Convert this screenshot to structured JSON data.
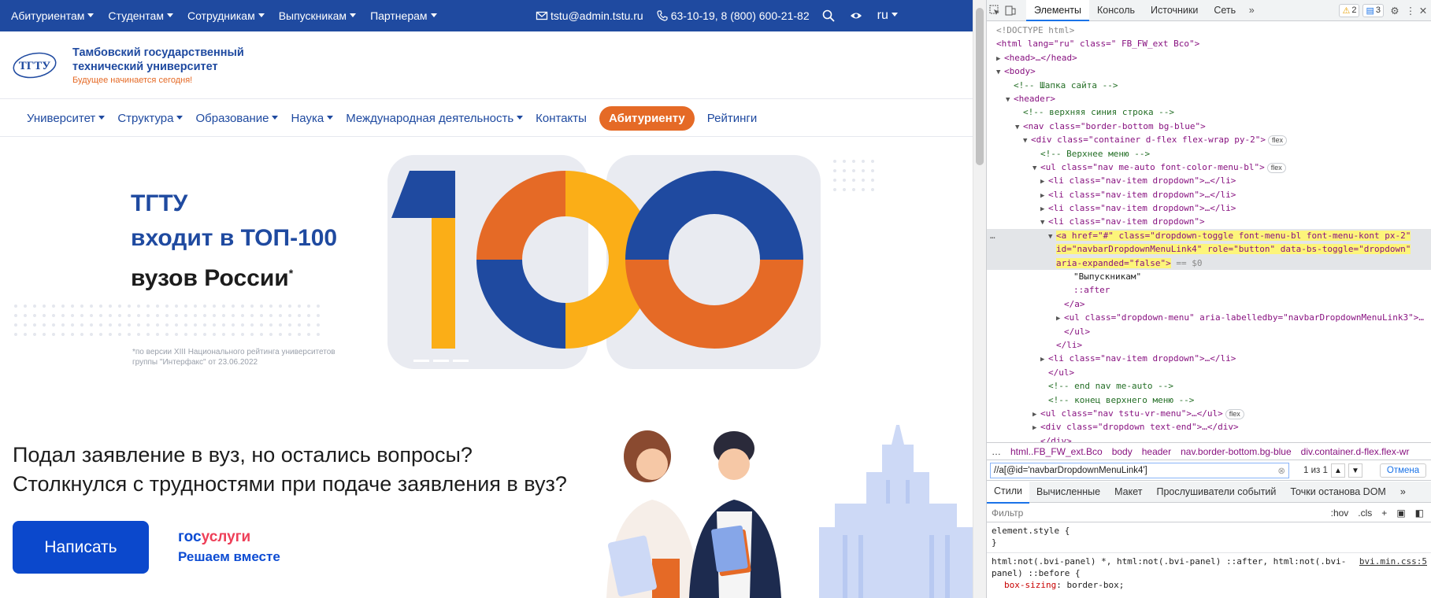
{
  "site": {
    "topbar": {
      "menu": [
        "Абитуриентам",
        "Студентам",
        "Сотрудникам",
        "Выпускникам",
        "Партнерам"
      ],
      "email": "tstu@admin.tstu.ru",
      "phone": "63-10-19, 8 (800) 600-21-82",
      "lang": "ru"
    },
    "brand": {
      "logo_text": "ТГТУ",
      "name_line1": "Тамбовский государственный",
      "name_line2": "технический университет",
      "motto": "Будущее  начинается сегодня!"
    },
    "mainnav": {
      "items": [
        "Университет",
        "Структура",
        "Образование",
        "Наука",
        "Международная деятельность"
      ],
      "contacts": "Контакты",
      "applicant": "Абитуриенту",
      "ratings": "Рейтинги"
    },
    "banner": {
      "line1": "ТГТУ",
      "line2": "входит в ТОП-100",
      "line3": "вузов России",
      "star": "*",
      "note1": "*по версии XIII Национального рейтинга университетов",
      "note2": " группы \"Интерфакс\" от 23.06.2022"
    },
    "promo": {
      "question1": "Подал заявление в вуз, но остались вопросы?",
      "question2": "Столкнулся с трудностями при подаче заявления в вуз?",
      "button": "Написать",
      "gos1": "гос",
      "gos2": "услуги",
      "gos_sub": "Решаем вместе"
    },
    "colors": {
      "brand_blue": "#1f4aa0",
      "accent_orange": "#e56a26",
      "yellow": "#fbae17"
    }
  },
  "devtools": {
    "tabs": [
      "Элементы",
      "Консоль",
      "Источники",
      "Сеть"
    ],
    "warnings": "2",
    "messages": "3",
    "tree": [
      {
        "t": "<!DOCTYPE html>"
      },
      {
        "t": "<html lang=\"ru\" class=\" FB_FW_ext Bco\">"
      },
      {
        "t": "<head>…</head>"
      },
      {
        "t": "<body>"
      },
      {
        "t": "<!-- Шапка сайта -->"
      },
      {
        "t": "<header>"
      },
      {
        "t": "<!-- верхняя синия строка -->"
      },
      {
        "t": "<nav class=\"border-bottom bg-blue\">"
      },
      {
        "t": "<div class=\"container d-flex flex-wrap py-2\">"
      },
      {
        "t": "<!-- Верхнее меню -->"
      },
      {
        "t": "<ul class=\"nav me-auto font-color-menu-bl\">"
      },
      {
        "t": "<li class=\"nav-item dropdown\">…</li>"
      },
      {
        "t": "<li class=\"nav-item dropdown\">…</li>"
      },
      {
        "t": "<li class=\"nav-item dropdown\">…</li>"
      },
      {
        "t": "<li class=\"nav-item dropdown\">"
      },
      {
        "t": "<a href=\"#\" class=\"dropdown-toggle font-menu-bl font-menu-kont px-2\""
      },
      {
        "t": "id=\"navbarDropdownMenuLink4\" role=\"button\" data-bs-toggle=\"dropdown\""
      },
      {
        "t": "aria-expanded=\"false\">"
      },
      {
        "t": "\"Выпускникам\""
      },
      {
        "t": "::after"
      },
      {
        "t": "</a>"
      },
      {
        "t": "<ul class=\"dropdown-menu\" aria-labelledby=\"navbarDropdownMenuLink3\">…"
      },
      {
        "t": "</ul>"
      },
      {
        "t": "</li>"
      },
      {
        "t": "<li class=\"nav-item dropdown\">…</li>"
      },
      {
        "t": "</ul>"
      },
      {
        "t": "<!-- end  nav me-auto -->"
      },
      {
        "t": "<!-- конец верхнего меню -->"
      },
      {
        "t": "<ul class=\"nav tstu-vr-menu\">…</ul>"
      },
      {
        "t": "<div class=\"dropdown text-end\">…</div>"
      },
      {
        "t": "</div>"
      }
    ],
    "flex_badge": "flex",
    "selected_suffix": "== $0",
    "crumbs": [
      "…",
      "html..FB_FW_ext.Bco",
      "body",
      "header",
      "nav.border-bottom.bg-blue",
      "div.container.d-flex.flex-wr"
    ],
    "xpath": "//a[@id='navbarDropdownMenuLink4']",
    "match_count": "1 из 1",
    "cancel": "Отмена",
    "subtabs": [
      "Стили",
      "Вычисленные",
      "Макет",
      "Прослушиватели событий",
      "Точки останова DOM"
    ],
    "filter_placeholder": "Фильтр",
    "filter_hov": ":hov",
    "filter_cls": ".cls",
    "element_style": "element.style {",
    "close_brace": "}",
    "rule_selector": "html:not(.bvi-panel) *, html:not(.bvi-panel) ::after, html:not(.bvi-panel) ::before {",
    "rule_source": "bvi.min.css:5",
    "rule_prop": "box-sizing",
    "rule_val": "border-box;"
  }
}
